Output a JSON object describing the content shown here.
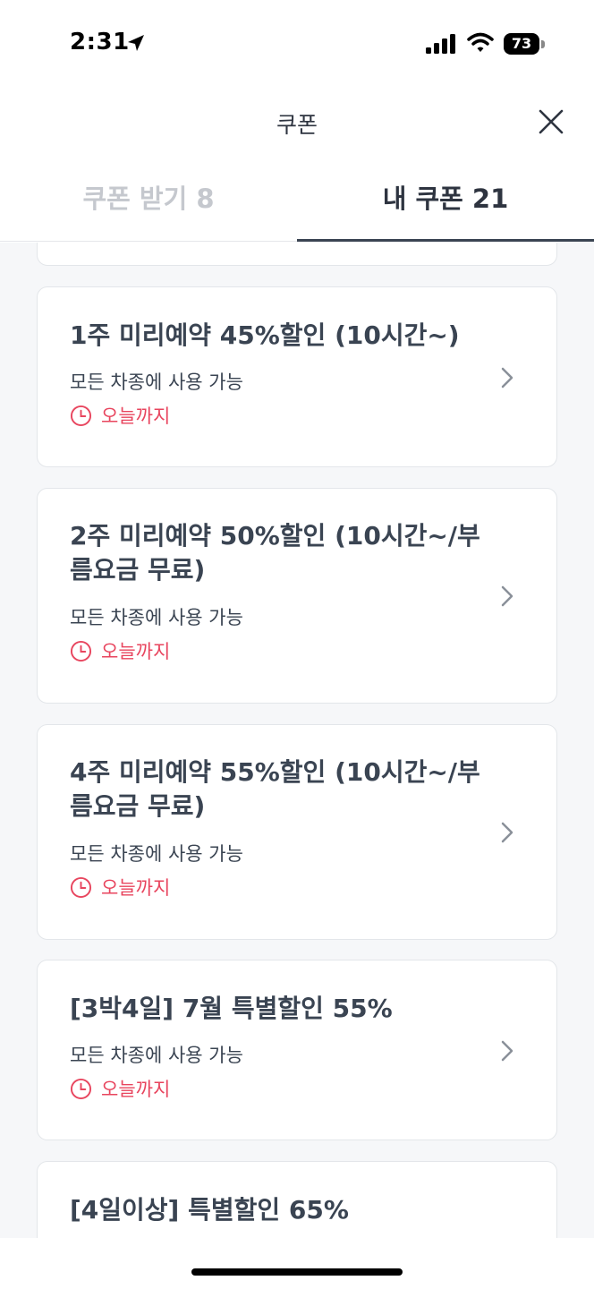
{
  "status_bar": {
    "time": "2:31",
    "battery": "73"
  },
  "header": {
    "title": "쿠폰"
  },
  "tabs": [
    {
      "label": "쿠폰 받기 8",
      "active": false
    },
    {
      "label": "내 쿠폰 21",
      "active": true
    }
  ],
  "coupons": [
    {
      "title": "1주 미리예약 45%할인 (10시간~)",
      "subtitle": "모든 차종에 사용 가능",
      "expiry": "오늘까지"
    },
    {
      "title": "2주 미리예약 50%할인 (10시간~/부름요금 무료)",
      "subtitle": "모든 차종에 사용 가능",
      "expiry": "오늘까지"
    },
    {
      "title": "4주 미리예약 55%할인 (10시간~/부름요금 무료)",
      "subtitle": "모든 차종에 사용 가능",
      "expiry": "오늘까지"
    },
    {
      "title": "[3박4일] 7월 특별할인 55%",
      "subtitle": "모든 차종에 사용 가능",
      "expiry": "오늘까지"
    },
    {
      "title": "[4일이상] 특별할인 65%"
    }
  ],
  "colors": {
    "accent": "#e8455e",
    "text": "#3a4452",
    "inactive_tab": "#c5c8ce",
    "list_bg": "#f6f7f9"
  }
}
